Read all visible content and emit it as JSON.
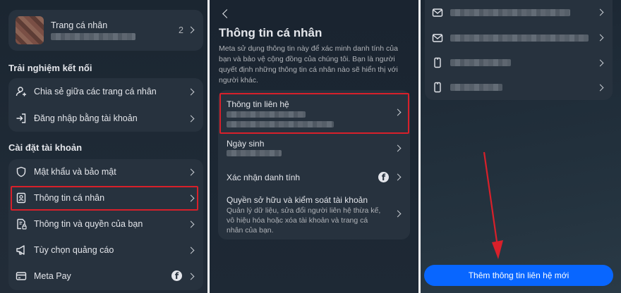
{
  "left": {
    "profile": {
      "label": "Trang cá nhân",
      "count": "2"
    },
    "section_connect": "Trải nghiệm kết nối",
    "connect_items": [
      {
        "label": "Chia sẻ giữa các trang cá nhân",
        "icon": "profile-share-icon"
      },
      {
        "label": "Đăng nhập bằng tài khoản",
        "icon": "login-arrow-icon"
      }
    ],
    "section_account": "Cài đặt tài khoản",
    "account_items": [
      {
        "label": "Mật khẩu và bảo mật",
        "icon": "shield-icon"
      },
      {
        "label": "Thông tin cá nhân",
        "icon": "id-card-icon"
      },
      {
        "label": "Thông tin và quyền của bạn",
        "icon": "document-lock-icon"
      },
      {
        "label": "Tùy chọn quảng cáo",
        "icon": "megaphone-icon"
      },
      {
        "label": "Meta Pay",
        "icon": "credit-card-icon"
      }
    ]
  },
  "middle": {
    "title": "Thông tin cá nhân",
    "description": "Meta sử dụng thông tin này để xác minh danh tính của bạn và bảo vệ cộng đồng của chúng tôi. Bạn là người quyết định những thông tin cá nhân nào sẽ hiển thị với người khác.",
    "items": {
      "contact": "Thông tin liên hệ",
      "birthday": "Ngày sinh",
      "identity": "Xác nhận danh tính",
      "ownership_title": "Quyền sở hữu và kiểm soát tài khoản",
      "ownership_desc": "Quản lý dữ liệu, sửa đổi người liên hệ thừa kế, vô hiệu hóa hoặc xóa tài khoản và trang cá nhân của bạn."
    }
  },
  "right": {
    "contacts": [
      {
        "icon": "mail-icon"
      },
      {
        "icon": "mail-icon"
      },
      {
        "icon": "phone-icon"
      },
      {
        "icon": "phone-icon"
      }
    ],
    "add_button": "Thêm thông tin liên hệ mới"
  },
  "colors": {
    "accent": "#0866ff",
    "highlight": "#d8202a",
    "card": "#27323e"
  }
}
